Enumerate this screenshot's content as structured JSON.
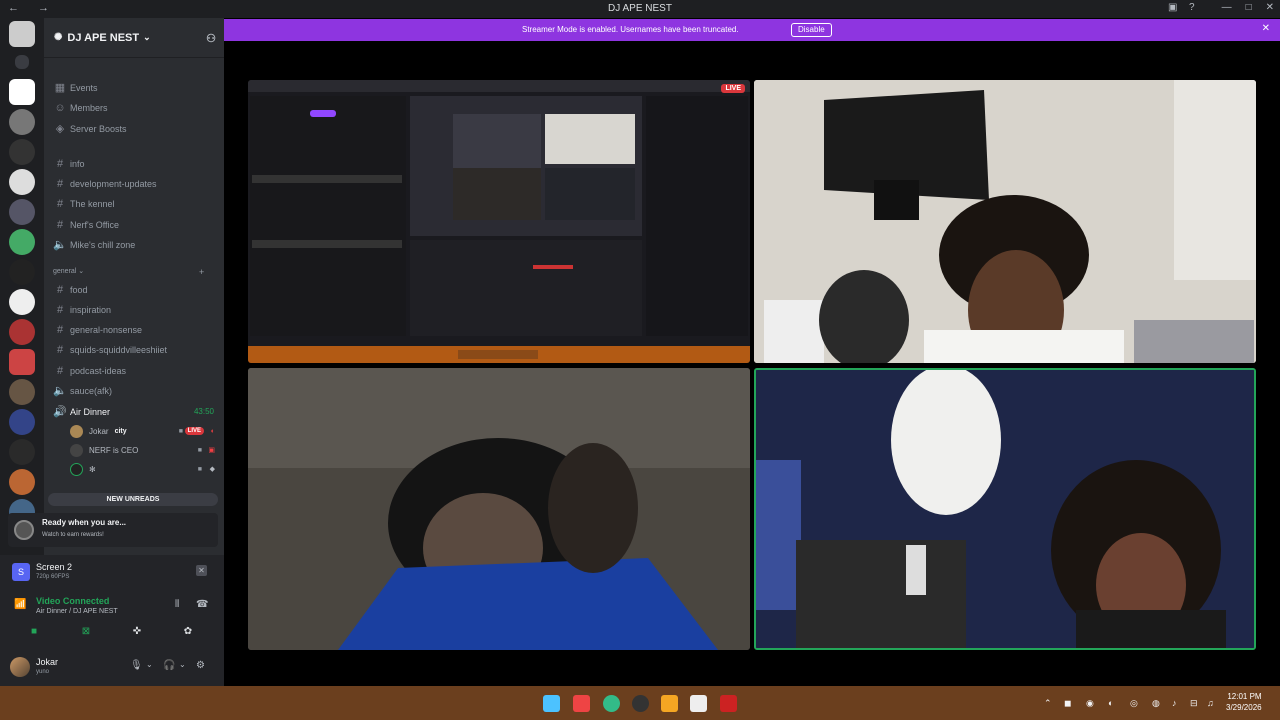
{
  "window": {
    "title": "DJ APE NEST"
  },
  "banner": {
    "message": "Streamer Mode is enabled. Usernames have been truncated.",
    "button": "Disable"
  },
  "server": {
    "name": "DJ APE NEST"
  },
  "nav_items": [
    {
      "label": "Events",
      "icon": "calendar-icon"
    },
    {
      "label": "Members",
      "icon": "members-icon"
    },
    {
      "label": "Server Boosts",
      "icon": "boost-icon"
    }
  ],
  "channels_top": [
    "info",
    "development-updates",
    "The kennel",
    "Nerf's Office"
  ],
  "voice_top": "Mike's chill zone",
  "category": "general",
  "channels_general": [
    "food",
    "inspiration",
    "general-nonsense",
    "squids-squiddvilleeshiiet",
    "podcast-ideas"
  ],
  "voice_general": [
    {
      "label": "sauce(afk)"
    },
    {
      "label": "Air Dinner",
      "timer": "43:50"
    }
  ],
  "voice_users": [
    {
      "name": "Jokar",
      "tag": "city",
      "live": "LIVE"
    },
    {
      "name": "NERF is CEO"
    },
    {
      "name": ""
    }
  ],
  "new_unreads": "NEW UNREADS",
  "quest": {
    "title": "Ready when you are...",
    "subtitle": "Watch to earn rewards!"
  },
  "stream": {
    "title": "Screen 2",
    "quality": "720p 60FPS"
  },
  "voice_status": {
    "title": "Video Connected",
    "subtitle": "Air Dinner / DJ APE NEST"
  },
  "user": {
    "name": "Jokar",
    "status": "yuno"
  },
  "tiles": [
    {
      "kind": "screenshare",
      "live": "LIVE"
    },
    {
      "kind": "camera"
    },
    {
      "kind": "camera"
    },
    {
      "kind": "camera",
      "speaking": true
    }
  ],
  "clock": {
    "time": "12:01 PM",
    "date": "3/29/2026"
  },
  "colors": {
    "banner": "#8e35e0",
    "voice_green": "#23a559",
    "live_red": "#da373c",
    "sidebar": "#2b2d31"
  }
}
